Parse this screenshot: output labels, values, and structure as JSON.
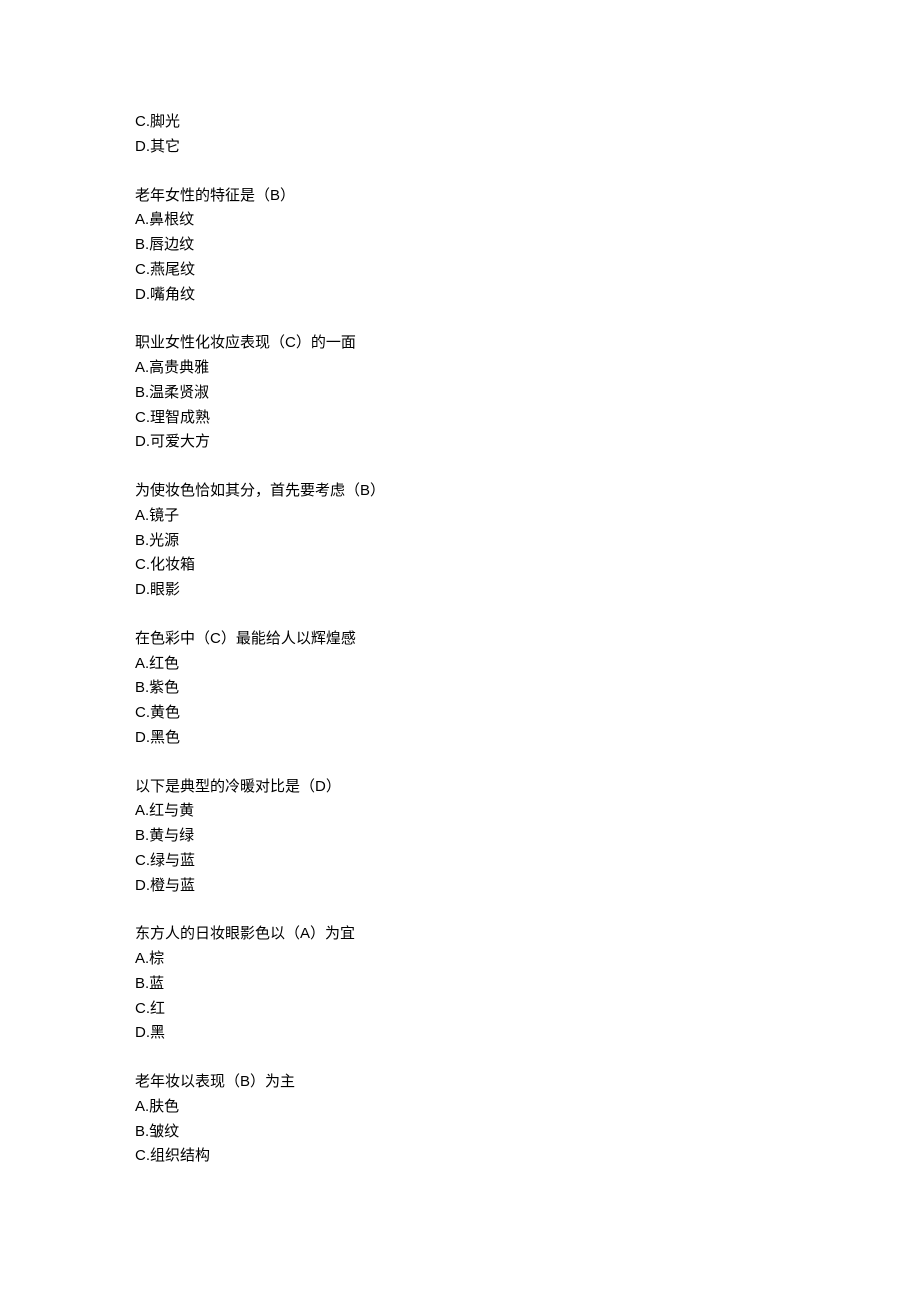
{
  "q0": {
    "options": {
      "c": "C.脚光",
      "d": "D.其它"
    }
  },
  "q1": {
    "stem": "老年女性的特征是（B）",
    "options": {
      "a": "A.鼻根纹",
      "b": "B.唇边纹",
      "c": "C.燕尾纹",
      "d": "D.嘴角纹"
    }
  },
  "q2": {
    "stem": "职业女性化妆应表现（C）的一面",
    "options": {
      "a": "A.高贵典雅",
      "b": "B.温柔贤淑",
      "c": "C.理智成熟",
      "d": "D.可爱大方"
    }
  },
  "q3": {
    "stem": "为使妆色恰如其分，首先要考虑（B）",
    "options": {
      "a": "A.镜子",
      "b": "B.光源",
      "c": "C.化妆箱",
      "d": "D.眼影"
    }
  },
  "q4": {
    "stem": "在色彩中（C）最能给人以辉煌感",
    "options": {
      "a": "A.红色",
      "b": "B.紫色",
      "c": "C.黄色",
      "d": "D.黑色"
    }
  },
  "q5": {
    "stem": "以下是典型的冷暖对比是（D）",
    "options": {
      "a": "A.红与黄",
      "b": "B.黄与绿",
      "c": "C.绿与蓝",
      "d": "D.橙与蓝"
    }
  },
  "q6": {
    "stem": "东方人的日妆眼影色以（A）为宜",
    "options": {
      "a": "A.棕",
      "b": "B.蓝",
      "c": "C.红",
      "d": "D.黑"
    }
  },
  "q7": {
    "stem": "老年妆以表现（B）为主",
    "options": {
      "a": "A.肤色",
      "b": "B.皱纹",
      "c": "C.组织结构"
    }
  }
}
